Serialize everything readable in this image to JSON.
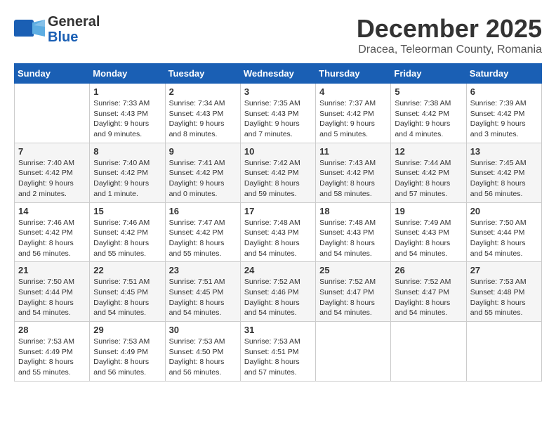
{
  "header": {
    "logo_line1": "General",
    "logo_line2": "Blue",
    "month": "December 2025",
    "location": "Dracea, Teleorman County, Romania"
  },
  "weekdays": [
    "Sunday",
    "Monday",
    "Tuesday",
    "Wednesday",
    "Thursday",
    "Friday",
    "Saturday"
  ],
  "weeks": [
    [
      {
        "day": "",
        "info": ""
      },
      {
        "day": "1",
        "info": "Sunrise: 7:33 AM\nSunset: 4:43 PM\nDaylight: 9 hours\nand 9 minutes."
      },
      {
        "day": "2",
        "info": "Sunrise: 7:34 AM\nSunset: 4:43 PM\nDaylight: 9 hours\nand 8 minutes."
      },
      {
        "day": "3",
        "info": "Sunrise: 7:35 AM\nSunset: 4:43 PM\nDaylight: 9 hours\nand 7 minutes."
      },
      {
        "day": "4",
        "info": "Sunrise: 7:37 AM\nSunset: 4:42 PM\nDaylight: 9 hours\nand 5 minutes."
      },
      {
        "day": "5",
        "info": "Sunrise: 7:38 AM\nSunset: 4:42 PM\nDaylight: 9 hours\nand 4 minutes."
      },
      {
        "day": "6",
        "info": "Sunrise: 7:39 AM\nSunset: 4:42 PM\nDaylight: 9 hours\nand 3 minutes."
      }
    ],
    [
      {
        "day": "7",
        "info": "Sunrise: 7:40 AM\nSunset: 4:42 PM\nDaylight: 9 hours\nand 2 minutes."
      },
      {
        "day": "8",
        "info": "Sunrise: 7:40 AM\nSunset: 4:42 PM\nDaylight: 9 hours\nand 1 minute."
      },
      {
        "day": "9",
        "info": "Sunrise: 7:41 AM\nSunset: 4:42 PM\nDaylight: 9 hours\nand 0 minutes."
      },
      {
        "day": "10",
        "info": "Sunrise: 7:42 AM\nSunset: 4:42 PM\nDaylight: 8 hours\nand 59 minutes."
      },
      {
        "day": "11",
        "info": "Sunrise: 7:43 AM\nSunset: 4:42 PM\nDaylight: 8 hours\nand 58 minutes."
      },
      {
        "day": "12",
        "info": "Sunrise: 7:44 AM\nSunset: 4:42 PM\nDaylight: 8 hours\nand 57 minutes."
      },
      {
        "day": "13",
        "info": "Sunrise: 7:45 AM\nSunset: 4:42 PM\nDaylight: 8 hours\nand 56 minutes."
      }
    ],
    [
      {
        "day": "14",
        "info": "Sunrise: 7:46 AM\nSunset: 4:42 PM\nDaylight: 8 hours\nand 56 minutes."
      },
      {
        "day": "15",
        "info": "Sunrise: 7:46 AM\nSunset: 4:42 PM\nDaylight: 8 hours\nand 55 minutes."
      },
      {
        "day": "16",
        "info": "Sunrise: 7:47 AM\nSunset: 4:42 PM\nDaylight: 8 hours\nand 55 minutes."
      },
      {
        "day": "17",
        "info": "Sunrise: 7:48 AM\nSunset: 4:43 PM\nDaylight: 8 hours\nand 54 minutes."
      },
      {
        "day": "18",
        "info": "Sunrise: 7:48 AM\nSunset: 4:43 PM\nDaylight: 8 hours\nand 54 minutes."
      },
      {
        "day": "19",
        "info": "Sunrise: 7:49 AM\nSunset: 4:43 PM\nDaylight: 8 hours\nand 54 minutes."
      },
      {
        "day": "20",
        "info": "Sunrise: 7:50 AM\nSunset: 4:44 PM\nDaylight: 8 hours\nand 54 minutes."
      }
    ],
    [
      {
        "day": "21",
        "info": "Sunrise: 7:50 AM\nSunset: 4:44 PM\nDaylight: 8 hours\nand 54 minutes."
      },
      {
        "day": "22",
        "info": "Sunrise: 7:51 AM\nSunset: 4:45 PM\nDaylight: 8 hours\nand 54 minutes."
      },
      {
        "day": "23",
        "info": "Sunrise: 7:51 AM\nSunset: 4:45 PM\nDaylight: 8 hours\nand 54 minutes."
      },
      {
        "day": "24",
        "info": "Sunrise: 7:52 AM\nSunset: 4:46 PM\nDaylight: 8 hours\nand 54 minutes."
      },
      {
        "day": "25",
        "info": "Sunrise: 7:52 AM\nSunset: 4:47 PM\nDaylight: 8 hours\nand 54 minutes."
      },
      {
        "day": "26",
        "info": "Sunrise: 7:52 AM\nSunset: 4:47 PM\nDaylight: 8 hours\nand 54 minutes."
      },
      {
        "day": "27",
        "info": "Sunrise: 7:53 AM\nSunset: 4:48 PM\nDaylight: 8 hours\nand 55 minutes."
      }
    ],
    [
      {
        "day": "28",
        "info": "Sunrise: 7:53 AM\nSunset: 4:49 PM\nDaylight: 8 hours\nand 55 minutes."
      },
      {
        "day": "29",
        "info": "Sunrise: 7:53 AM\nSunset: 4:49 PM\nDaylight: 8 hours\nand 56 minutes."
      },
      {
        "day": "30",
        "info": "Sunrise: 7:53 AM\nSunset: 4:50 PM\nDaylight: 8 hours\nand 56 minutes."
      },
      {
        "day": "31",
        "info": "Sunrise: 7:53 AM\nSunset: 4:51 PM\nDaylight: 8 hours\nand 57 minutes."
      },
      {
        "day": "",
        "info": ""
      },
      {
        "day": "",
        "info": ""
      },
      {
        "day": "",
        "info": ""
      }
    ]
  ]
}
